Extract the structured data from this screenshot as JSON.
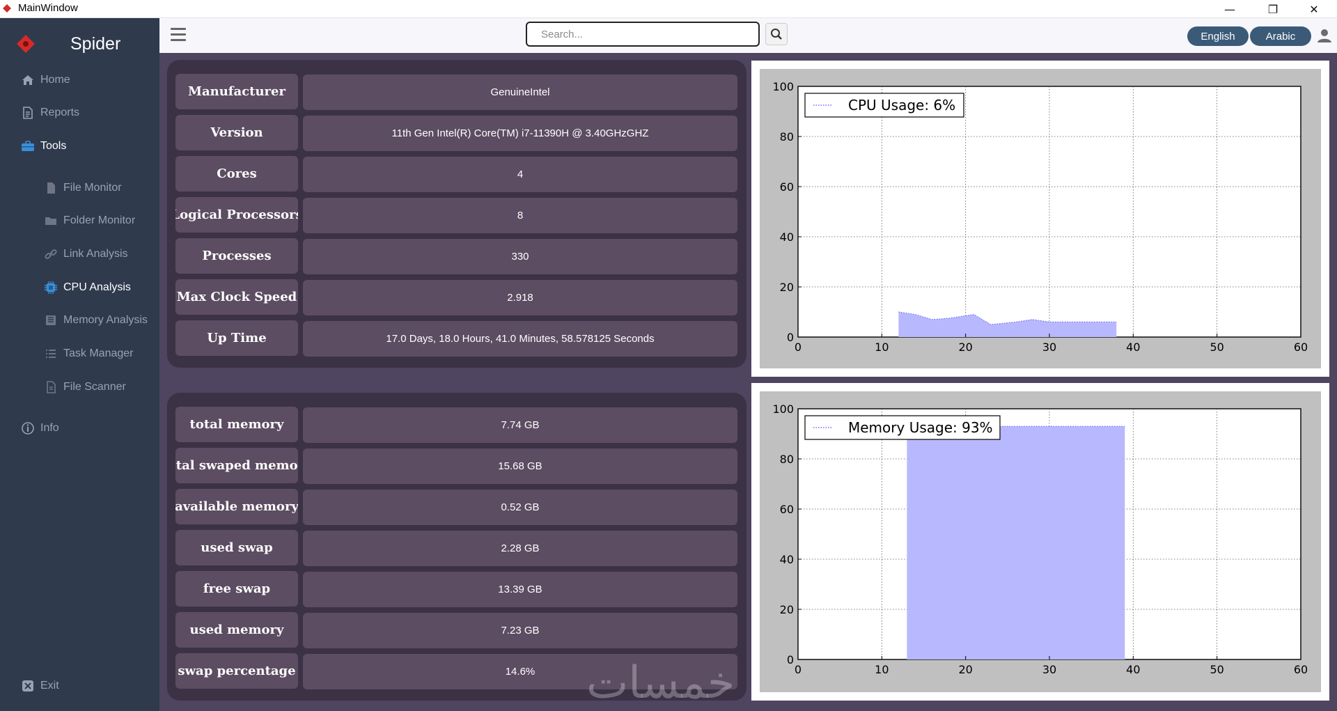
{
  "window": {
    "title": "MainWindow",
    "minimize": "—",
    "restore": "❐",
    "close": "✕"
  },
  "sidebar": {
    "brand": "Spider",
    "items": [
      {
        "label": "Home"
      },
      {
        "label": "Reports"
      },
      {
        "label": "Tools"
      },
      {
        "label": "File Monitor"
      },
      {
        "label": "Folder Monitor"
      },
      {
        "label": "Link Analysis"
      },
      {
        "label": "CPU Analysis"
      },
      {
        "label": "Memory Analysis"
      },
      {
        "label": "Task Manager"
      },
      {
        "label": "File Scanner"
      },
      {
        "label": "Info"
      },
      {
        "label": "Exit"
      }
    ]
  },
  "topbar": {
    "search_placeholder": "Search...",
    "lang_english": "English",
    "lang_arabic": "Arabic"
  },
  "cpu_info": [
    {
      "label": "Manufacturer",
      "value": "GenuineIntel"
    },
    {
      "label": "Version",
      "value": "11th Gen Intel(R) Core(TM) i7-11390H @ 3.40GHzGHZ"
    },
    {
      "label": "Cores",
      "value": "4"
    },
    {
      "label": "Logical Processors",
      "value": "8"
    },
    {
      "label": "Processes",
      "value": "330"
    },
    {
      "label": "Max Clock Speed",
      "value": "2.918"
    },
    {
      "label": "Up Time",
      "value": "17.0 Days, 18.0 Hours, 41.0 Minutes, 58.578125 Seconds"
    }
  ],
  "memory_info": [
    {
      "label": "total memory",
      "value": "7.74 GB"
    },
    {
      "label": "total swaped memory",
      "value": "15.68 GB"
    },
    {
      "label": "available memory",
      "value": "0.52 GB"
    },
    {
      "label": "used swap",
      "value": "2.28 GB"
    },
    {
      "label": "free swap",
      "value": "13.39 GB"
    },
    {
      "label": "used memory",
      "value": "7.23 GB"
    },
    {
      "label": "swap percentage",
      "value": "14.6%"
    }
  ],
  "watermark": "خمسات",
  "chart_data": [
    {
      "type": "area",
      "legend": "CPU Usage: 6%",
      "series": [
        {
          "name": "CPU Usage: 6%",
          "x": [
            12,
            14,
            16,
            18,
            20,
            21,
            23,
            26,
            28,
            30,
            34,
            38
          ],
          "y": [
            10,
            9,
            7,
            7.5,
            8.5,
            9,
            5,
            6,
            7,
            6,
            6,
            6
          ]
        }
      ],
      "xlim": [
        0,
        60
      ],
      "ylim": [
        0,
        100
      ],
      "xticks": [
        0,
        10,
        20,
        30,
        40,
        50,
        60
      ],
      "yticks": [
        0,
        20,
        40,
        60,
        80,
        100
      ],
      "grid": true,
      "legend_position": "top-left",
      "color": "#b8b8ff",
      "line_color": "#6b6bff"
    },
    {
      "type": "area",
      "legend": "Memory Usage: 93%",
      "series": [
        {
          "name": "Memory Usage: 93%",
          "x": [
            13,
            39
          ],
          "y": [
            93,
            93
          ]
        }
      ],
      "xlim": [
        0,
        60
      ],
      "ylim": [
        0,
        100
      ],
      "xticks": [
        0,
        10,
        20,
        30,
        40,
        50,
        60
      ],
      "yticks": [
        0,
        20,
        40,
        60,
        80,
        100
      ],
      "grid": true,
      "legend_position": "top-left",
      "color": "#b8b8ff",
      "line_color": "#6b6bff"
    }
  ]
}
